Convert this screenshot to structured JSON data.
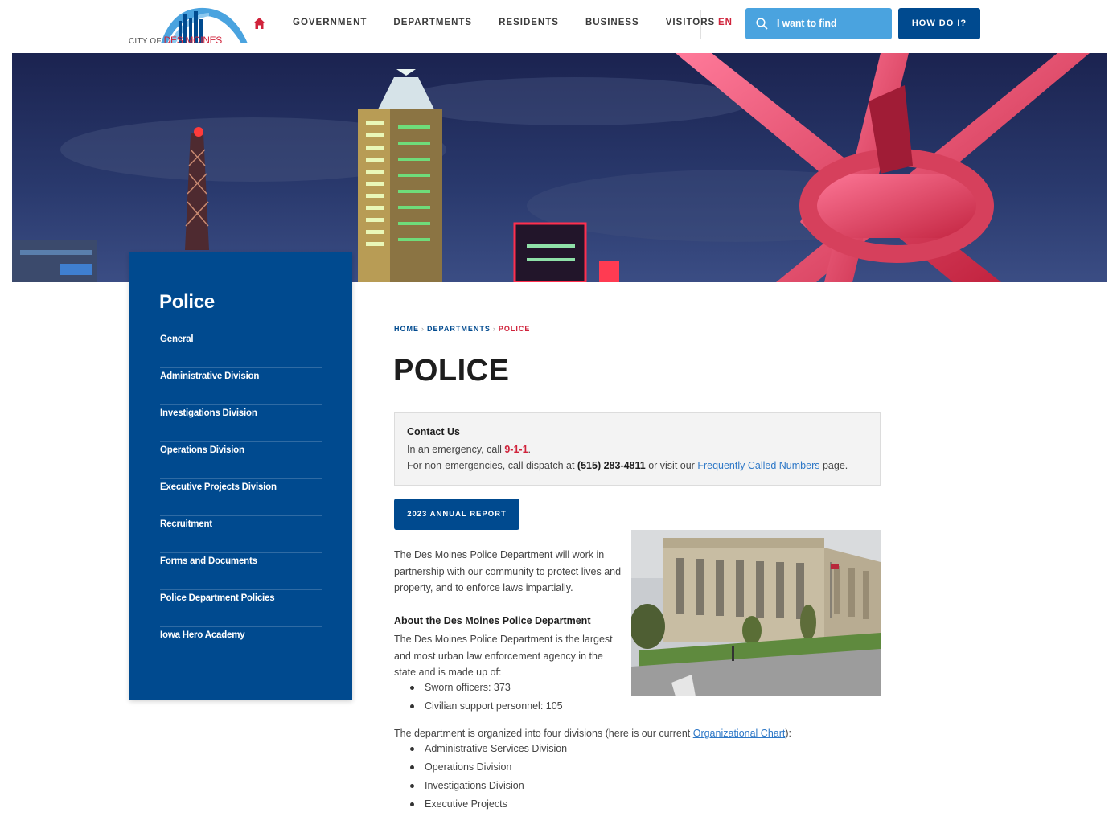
{
  "header": {
    "logo_prefix": "CITY OF",
    "logo_name": "DES MOINES",
    "nav": [
      "GOVERNMENT",
      "DEPARTMENTS",
      "RESIDENTS",
      "BUSINESS",
      "VISITORS"
    ],
    "language": "EN",
    "search_placeholder": "I want to find",
    "how_do_i": "HOW DO I?"
  },
  "sidebar": {
    "title": "Police",
    "items": [
      {
        "label": "General"
      },
      {
        "label": "Administrative Division"
      },
      {
        "label": "Investigations Division"
      },
      {
        "label": "Operations Division"
      },
      {
        "label": "Executive Projects Division"
      },
      {
        "label": "Recruitment"
      },
      {
        "label": "Forms and Documents"
      },
      {
        "label": "Police Department Policies"
      },
      {
        "label": "Iowa Hero Academy"
      }
    ]
  },
  "breadcrumb": {
    "home": "HOME",
    "departments": "DEPARTMENTS",
    "current": "POLICE",
    "separator": "›"
  },
  "main": {
    "title": "POLICE",
    "contact": {
      "title": "Contact Us",
      "emergency_prefix": "In an emergency, call ",
      "emergency_number": "9-1-1",
      "emergency_suffix": ".",
      "nonemergency_prefix": "For non-emergencies, call dispatch at ",
      "dispatch_number": "(515) 283-4811",
      "nonemergency_middle": " or visit our ",
      "numbers_link": "Frequently Called Numbers",
      "nonemergency_suffix": " page."
    },
    "report_button": "2023 ANNUAL REPORT",
    "intro": "The Des Moines Police Department will work in partnership with our community to protect lives and property, and to enforce laws impartially.",
    "about_heading": "About the Des Moines Police Department",
    "about_text": "The Des Moines Police Department is the largest and most urban law enforcement agency in the state and is made up of:",
    "staff": [
      {
        "label": "Sworn officers:  373"
      },
      {
        "label": "Civilian support personnel:  105"
      }
    ],
    "divisions_prefix": "The department is organized into four divisions (here is our current ",
    "org_chart_link": "Organizational Chart",
    "divisions_suffix": "):",
    "divisions": [
      {
        "label": "Administrative Services Division"
      },
      {
        "label": "Operations Division"
      },
      {
        "label": "Investigations Division"
      },
      {
        "label": "Executive Projects"
      }
    ]
  },
  "colors": {
    "brand_blue": "#004a8f",
    "accent_red": "#d0233b",
    "search_blue": "#4aa3df"
  }
}
